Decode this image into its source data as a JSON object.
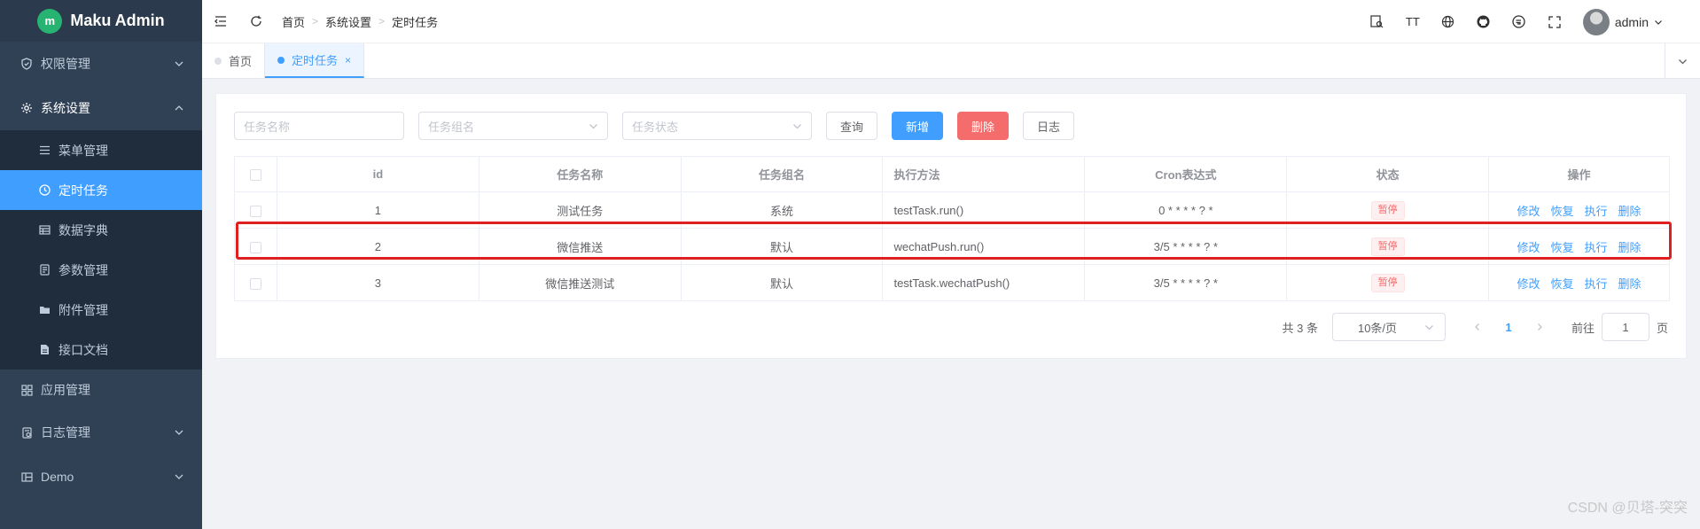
{
  "app": {
    "title": "Maku Admin",
    "logo_glyph": "m"
  },
  "sidebar": {
    "items": [
      {
        "label": "权限管理",
        "icon": "shield-check-icon",
        "expanded": false
      },
      {
        "label": "系统设置",
        "icon": "gear-icon",
        "expanded": true
      },
      {
        "label": "应用管理",
        "icon": "grid-icon",
        "expanded": false
      },
      {
        "label": "日志管理",
        "icon": "log-icon",
        "expanded": false
      },
      {
        "label": "Demo",
        "icon": "layout-icon",
        "expanded": false
      }
    ],
    "submenu": [
      {
        "label": "菜单管理",
        "icon": "list-icon"
      },
      {
        "label": "定时任务",
        "icon": "clock-icon",
        "active": true
      },
      {
        "label": "数据字典",
        "icon": "table-icon"
      },
      {
        "label": "参数管理",
        "icon": "params-icon"
      },
      {
        "label": "附件管理",
        "icon": "folder-icon"
      },
      {
        "label": "接口文档",
        "icon": "document-icon"
      }
    ]
  },
  "header": {
    "breadcrumb": [
      "首页",
      "系统设置",
      "定时任务"
    ],
    "user": "admin",
    "tool_text_icon": "TT"
  },
  "tabs": [
    {
      "label": "首页",
      "active": false
    },
    {
      "label": "定时任务",
      "active": true,
      "close": "×"
    }
  ],
  "filters": {
    "task_name_placeholder": "任务名称",
    "task_group_placeholder": "任务组名",
    "task_status_placeholder": "任务状态",
    "query": "查询",
    "add": "新增",
    "delete": "删除",
    "log": "日志"
  },
  "table": {
    "columns": [
      "id",
      "任务名称",
      "任务组名",
      "执行方法",
      "Cron表达式",
      "状态",
      "操作"
    ],
    "rows": [
      {
        "id": "1",
        "name": "测试任务",
        "group": "系统",
        "method": "testTask.run()",
        "cron": "0 * * * * ? *",
        "status": "暂停"
      },
      {
        "id": "2",
        "name": "微信推送",
        "group": "默认",
        "method": "wechatPush.run()",
        "cron": "3/5 * * * * ? *",
        "status": "暂停"
      },
      {
        "id": "3",
        "name": "微信推送测试",
        "group": "默认",
        "method": "testTask.wechatPush()",
        "cron": "3/5 * * * * ? *",
        "status": "暂停"
      }
    ],
    "actions": [
      "修改",
      "恢复",
      "执行",
      "删除"
    ]
  },
  "pager": {
    "total": "共 3 条",
    "page_size": "10条/页",
    "current": "1",
    "goto": "前往",
    "goto_value": "1",
    "page_unit": "页"
  },
  "watermark": "CSDN @贝塔-突突",
  "colors": {
    "accent": "#409eff",
    "danger": "#f56c6c",
    "sidebar": "#304156",
    "highlight": "#e02020"
  }
}
